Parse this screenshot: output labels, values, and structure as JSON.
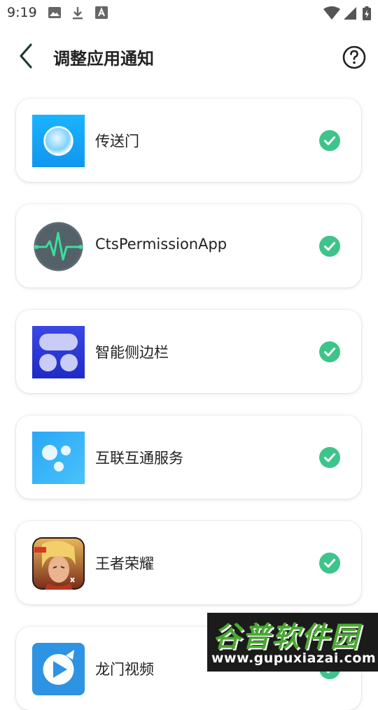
{
  "status_bar": {
    "time": "9:19"
  },
  "header": {
    "title": "调整应用通知"
  },
  "apps": [
    {
      "name": "传送门",
      "icon": "portal-app-icon",
      "notifications_enabled": true
    },
    {
      "name": "CtsPermissionApp",
      "icon": "heartbeat-app-icon",
      "notifications_enabled": true
    },
    {
      "name": "智能侧边栏",
      "icon": "smart-sidebar-app-icon",
      "notifications_enabled": true
    },
    {
      "name": "互联互通服务",
      "icon": "interconnect-app-icon",
      "notifications_enabled": true
    },
    {
      "name": "王者荣耀",
      "icon": "game-hero-app-icon",
      "notifications_enabled": true
    },
    {
      "name": "龙门视频",
      "icon": "video-app-icon",
      "notifications_enabled": true
    }
  ],
  "watermark": {
    "title": "谷普软件园",
    "url": "www.gupuxiazai.com"
  },
  "colors": {
    "check": "#3ec48a",
    "accent_blue": "#29a3f0"
  }
}
